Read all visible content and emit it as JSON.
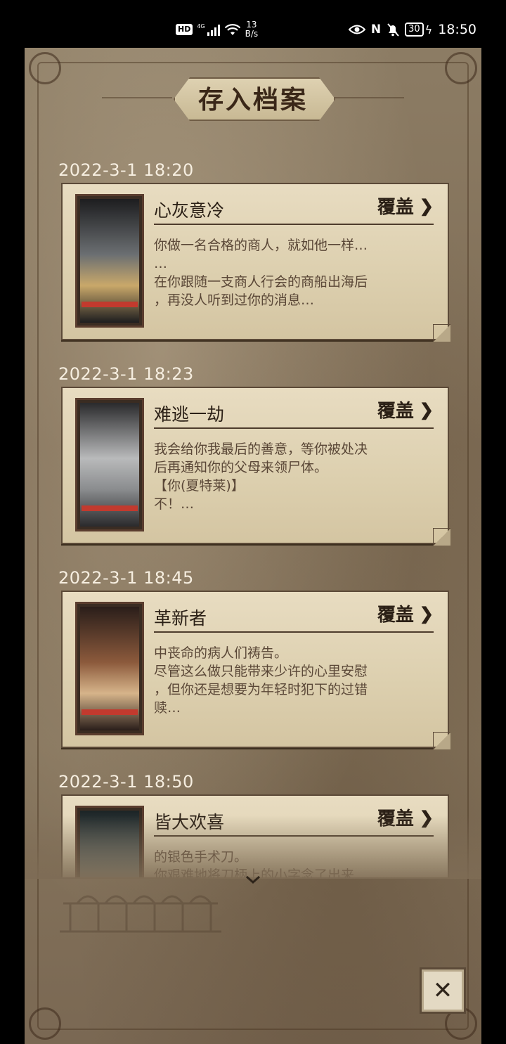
{
  "status_bar": {
    "hd": "HD",
    "network": "4G",
    "speed_value": "13",
    "speed_unit": "B/s",
    "nfc": "N",
    "battery": "30",
    "time": "18:50"
  },
  "dialog": {
    "title": "存入档案"
  },
  "saves": [
    {
      "timestamp": "2022-3-1  18:20",
      "title": "心灰意冷",
      "cover_label": "覆盖",
      "lines": [
        "你做一名合格的商人，就如他一样…",
        "…",
        "在你跟随一支商人行会的商船出海后",
        "，再没人听到过你的消息…"
      ],
      "thumb_colors": [
        "#1d1d1f",
        "#6b6f72",
        "#c9a86a"
      ]
    },
    {
      "timestamp": "2022-3-1  18:23",
      "title": "难逃一劫",
      "cover_label": "覆盖",
      "lines": [
        "我会给你我最后的善意，等你被处决",
        "后再通知你的父母来领尸体。",
        "【你(夏特莱)】",
        "不！…"
      ],
      "thumb_colors": [
        "#2a2a2c",
        "#b9babb",
        "#8a8c8e"
      ]
    },
    {
      "timestamp": "2022-3-1  18:45",
      "title": "革新者",
      "cover_label": "覆盖",
      "lines": [
        "中丧命的病人们祷告。",
        "尽管这么做只能带来少许的心里安慰",
        "，但你还是想要为年轻时犯下的过错",
        "赎…"
      ],
      "thumb_colors": [
        "#2a1e1a",
        "#8c5a3c",
        "#d6b48a"
      ]
    },
    {
      "timestamp": "2022-3-1  18:50",
      "title": "皆大欢喜",
      "cover_label": "覆盖",
      "lines": [
        "的银色手术刀。",
        "你艰难地将刀柄上的小字念了出来"
      ],
      "thumb_colors": [
        "#1c2426",
        "#5c6a6a",
        "#a8a898"
      ]
    }
  ],
  "close_label": "✕",
  "colors": {
    "panel": "#86755d",
    "card": "#e2d6ba",
    "text_dark": "#2b2016",
    "text_body": "#5a4737"
  }
}
